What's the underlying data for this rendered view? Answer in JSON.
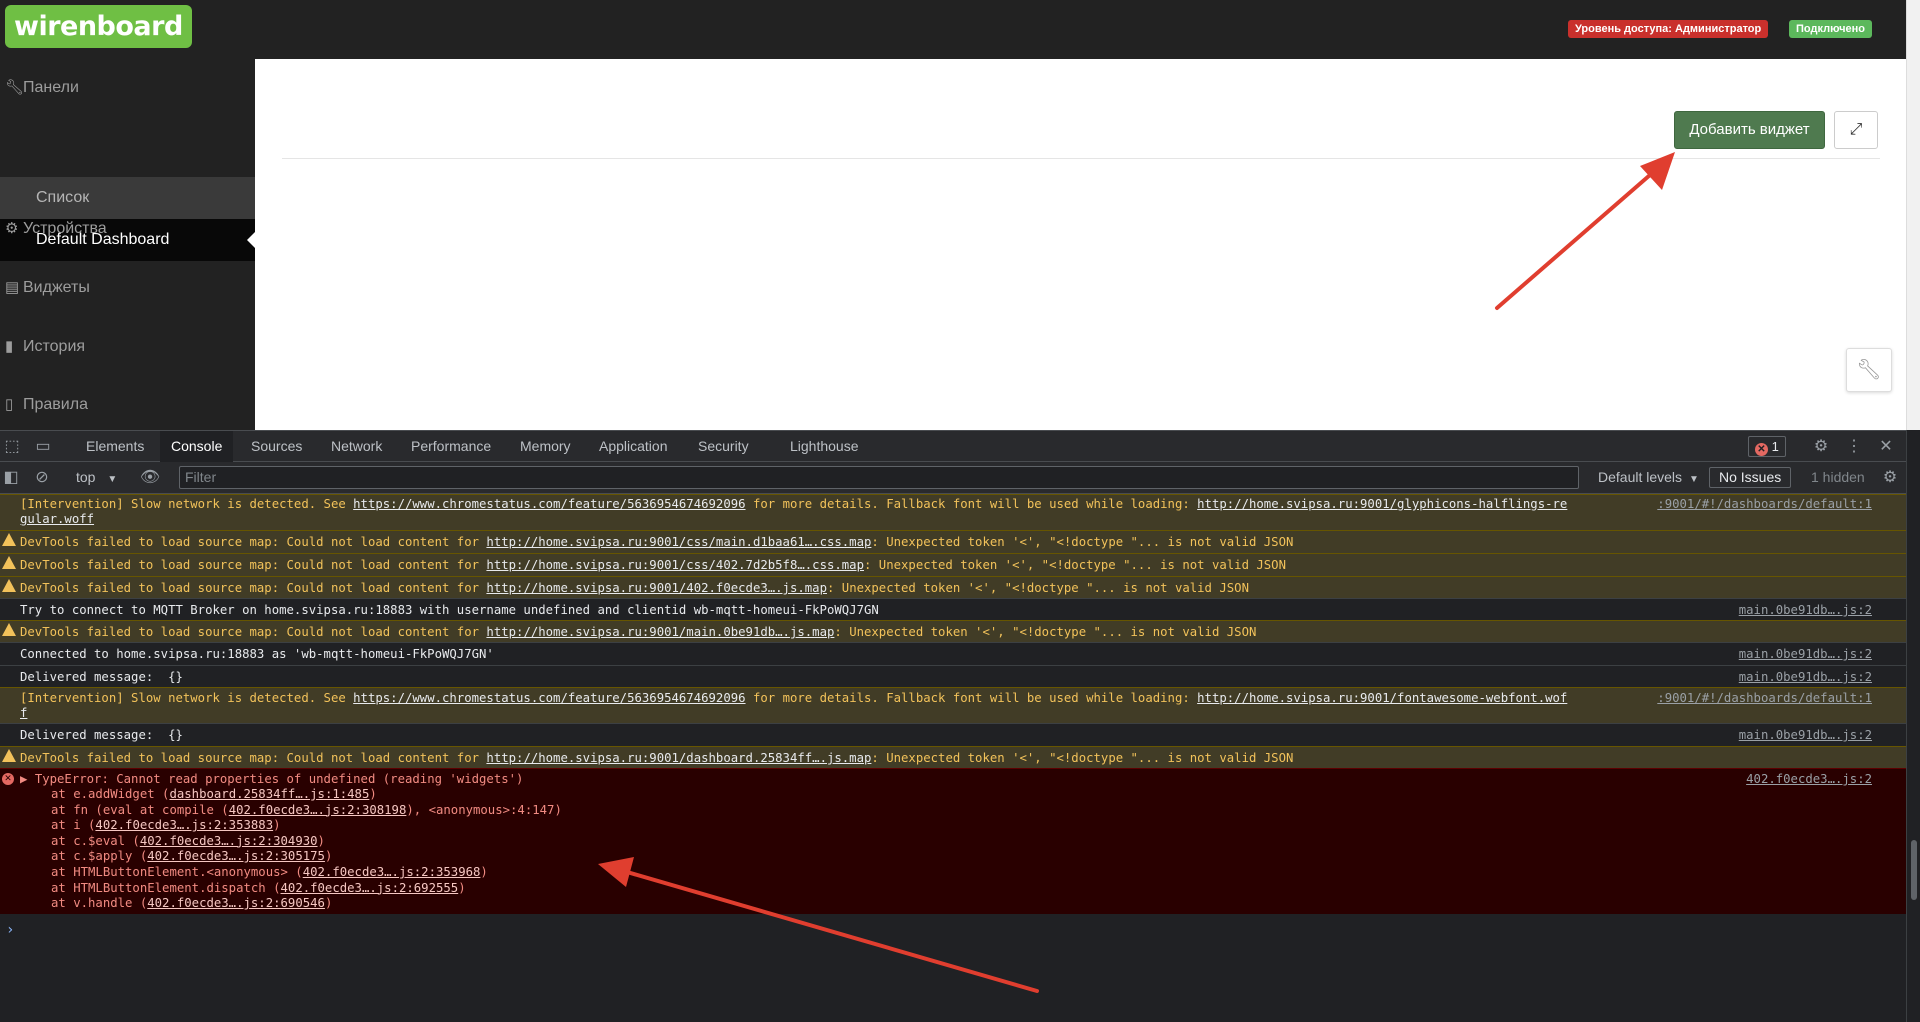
{
  "app": {
    "logo": "wirenboard",
    "access_badge": "Уровень доступа: Администратор",
    "connection_badge": "Подключено"
  },
  "sidebar": {
    "panels": "Панели",
    "list": "Список",
    "default_dashboard": "Default Dashboard",
    "devices": "Устройства",
    "widgets": "Виджеты",
    "history": "История",
    "rules": "Правила"
  },
  "main": {
    "add_widget": "Добавить виджет"
  },
  "devtools": {
    "tabs": [
      "Elements",
      "Console",
      "Sources",
      "Network",
      "Performance",
      "Memory",
      "Application",
      "Security",
      "Lighthouse"
    ],
    "error_count": "1",
    "context": "top",
    "filter_placeholder": "Filter",
    "levels": "Default levels",
    "issues": "No Issues",
    "hidden": "1 hidden"
  },
  "console": {
    "l1a": "[Intervention] Slow network is detected. See ",
    "l1link": "https://www.chromestatus.com/feature/5636954674692096",
    "l1b": " for more details. Fallback font will be used while loading: ",
    "l1font": "http://home.svipsa.ru:9001/glyphicons-halflings-re",
    "l1src": ":9001/#!/dashboards/default:1",
    "l1cont": "gular.woff",
    "sm_prefix": "DevTools failed to load source map: Could not load content for ",
    "sm_suffix": ": Unexpected token '<', \"<!doctype \"... is not valid JSON",
    "l2link": "http://home.svipsa.ru:9001/css/main.d1baa61….css.map",
    "l3link": "http://home.svipsa.ru:9001/css/402.7d2b5f8….css.map",
    "l4link": "http://home.svipsa.ru:9001/402.f0ecde3….js.map",
    "l5": "Try to connect to MQTT Broker on home.svipsa.ru:18883 with username undefined and clientid wb-mqtt-homeui-FkPoWQJ7GN",
    "l5src": "main.0be91db….js:2",
    "l6link": "http://home.svipsa.ru:9001/main.0be91db….js.map",
    "l7": "Connected to home.svipsa.ru:18883 as 'wb-mqtt-homeui-FkPoWQJ7GN'",
    "l7src": "main.0be91db….js:2",
    "l8": "Delivered message:  {}",
    "l8src": "main.0be91db….js:2",
    "l9font": "http://home.svipsa.ru:9001/fontawesome-webfont.wof",
    "l9src": ":9001/#!/dashboards/default:1",
    "l9cont": "f",
    "l10": "Delivered message:  {}",
    "l10src": "main.0be91db….js:2",
    "l11link": "http://home.svipsa.ru:9001/dashboard.25834ff….js.map",
    "err_head": "TypeError: Cannot read properties of undefined (reading 'widgets')",
    "err_src": "402.f0ecde3….js:2",
    "stack": [
      {
        "pre": "at e.addWidget (",
        "link": "dashboard.25834ff….js:1:485",
        "post": ")"
      },
      {
        "pre": "at fn (eval at compile (",
        "link": "402.f0ecde3….js:2:308198",
        "post": "), <anonymous>:4:147)"
      },
      {
        "pre": "at i (",
        "link": "402.f0ecde3….js:2:353883",
        "post": ")"
      },
      {
        "pre": "at c.$eval (",
        "link": "402.f0ecde3….js:2:304930",
        "post": ")"
      },
      {
        "pre": "at c.$apply (",
        "link": "402.f0ecde3….js:2:305175",
        "post": ")"
      },
      {
        "pre": "at HTMLButtonElement.<anonymous> (",
        "link": "402.f0ecde3….js:2:353968",
        "post": ")"
      },
      {
        "pre": "at HTMLButtonElement.dispatch (",
        "link": "402.f0ecde3….js:2:692555",
        "post": ")"
      },
      {
        "pre": "at v.handle (",
        "link": "402.f0ecde3….js:2:690546",
        "post": ")"
      }
    ]
  }
}
